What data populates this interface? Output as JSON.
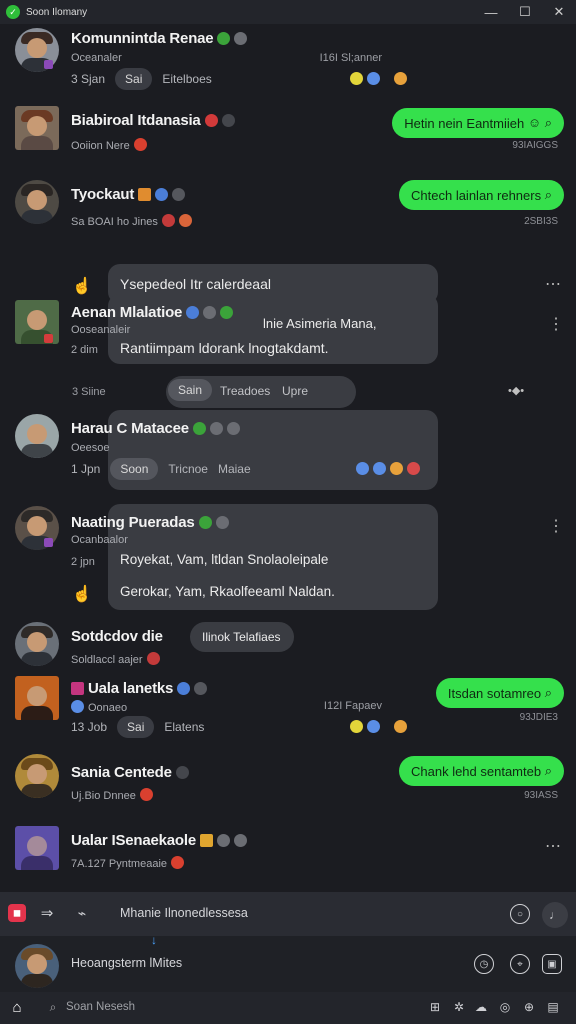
{
  "window": {
    "title": "Soon Ilomany",
    "minimize": "—",
    "maximize": "☐",
    "close": "✕"
  },
  "feed": [
    {
      "name": "Komunnintda Renae",
      "sub": "Oceanaler",
      "meta_left": "3 Sjan",
      "pill": "Sai",
      "pill_extra": "Eitelboes",
      "meta_right": "I16I Sl;anner"
    },
    {
      "name": "Biabiroal Itdanasia",
      "sub": "Ooiion   Nere",
      "green": "Hetin nein Eantmiieh",
      "ts": "93IAIGGS"
    },
    {
      "name": "Tyockaut",
      "sub": "Sa BOAI ho Jines",
      "green": "Chtech lainlan rehners",
      "ts": "2SBI3S",
      "bubble": "Ysepedeol Itr calerdeaal"
    },
    {
      "name": "Aenan Mlalatioe",
      "sub": "Ooseanaleir",
      "meta_left": "2 dim",
      "bubble_top": "lnie Asimeria Mana,",
      "bubble_bottom": "Rantiimpam ldorank lnogtakdamt."
    },
    {
      "meta_left": "3 Siine",
      "pill": "Sain",
      "pill_extra": "Treadoes",
      "pill_extra2": "Upre"
    },
    {
      "name": "Harau C Matacee",
      "sub": "Oeesoe",
      "meta_left": "1 Jpn",
      "pill": "Soon",
      "pill_extra": "Tricnoe",
      "pill_extra2": "Maiae"
    },
    {
      "name": "Naating Pueradas",
      "sub": "Ocanbaalor",
      "meta_left": "2 jpn",
      "line1": "Royekat, Vam, ltldan Snolaoleipale",
      "line2": "Gerokar, Yam, Rkaolfeeaml Naldan."
    },
    {
      "name": "Sotdcdov die",
      "chip": "Ilinok Telafiaes",
      "sub": "Soldlaccl aajer"
    },
    {
      "name": "Uala lanetks",
      "sub": "Oonaeo",
      "meta_left": "13 Job",
      "pill": "Sai",
      "pill_extra": "Elatens",
      "meta_right": "I12I Fapaev",
      "green": "Itsdan sotamreo",
      "ts": "93JDIE3"
    },
    {
      "name": "Sania Centede",
      "sub": "Uj.Bio   Dnnee",
      "green": "Chank lehd sentamteb",
      "ts": "93IASS"
    },
    {
      "name": "Ualar ISenaekaole",
      "sub": "7A.127   Pyntmeaaie"
    }
  ],
  "composer": {
    "placeholder": "Mhanie Ilnonedlessesa"
  },
  "reply": {
    "placeholder": "Heoangsterm lMites"
  },
  "search": {
    "placeholder": "Soan Nesesh"
  },
  "colors": {
    "background": "#1b1c21",
    "green_bubble": "#35e04c",
    "grey_bubble": "#3a3c42"
  }
}
